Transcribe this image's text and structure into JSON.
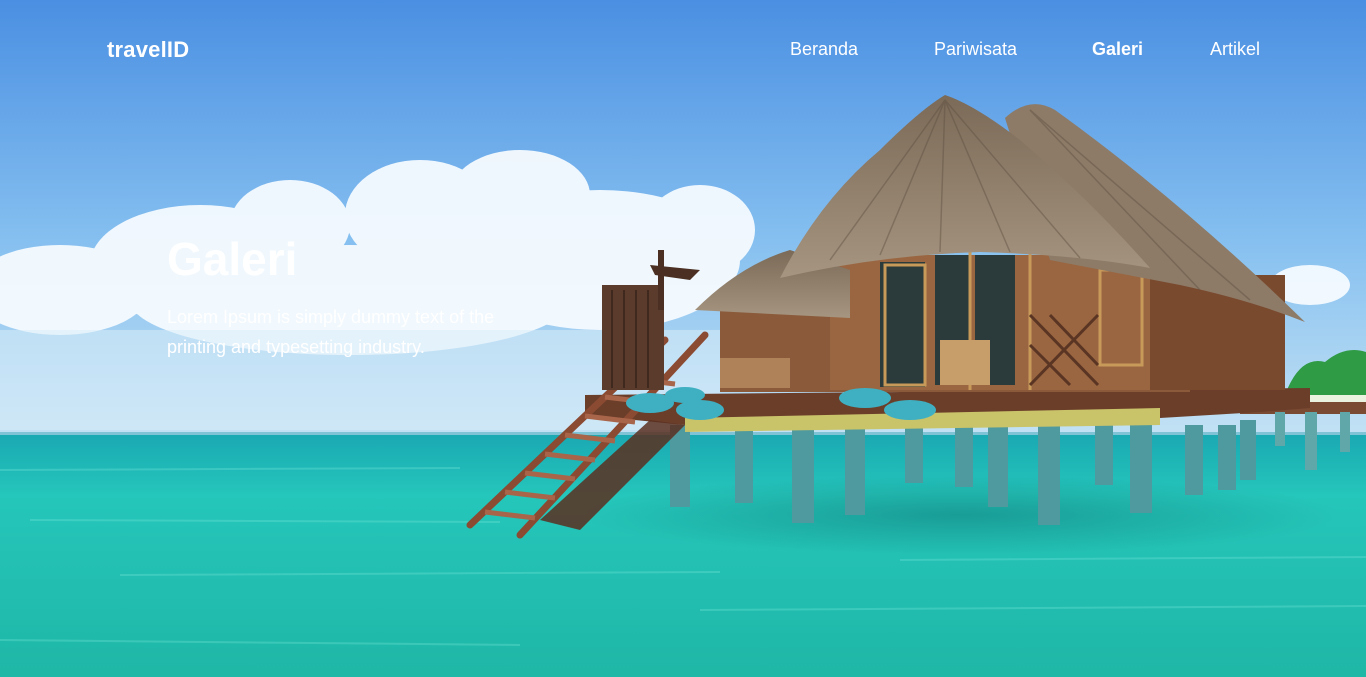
{
  "navbar": {
    "brand": "travelID",
    "links": [
      {
        "label": "Beranda",
        "active": false
      },
      {
        "label": "Pariwisata",
        "active": false
      },
      {
        "label": "Galeri",
        "active": true
      },
      {
        "label": "Artikel",
        "active": false
      }
    ]
  },
  "hero": {
    "title": "Galeri",
    "description": "Lorem Ipsum is simply dummy text of the printing and typesetting industry."
  },
  "colors": {
    "sky_top": "#4f95e4",
    "sky_bottom": "#a9d6f2",
    "sea": "#1fc3b4",
    "text": "#ffffff"
  }
}
